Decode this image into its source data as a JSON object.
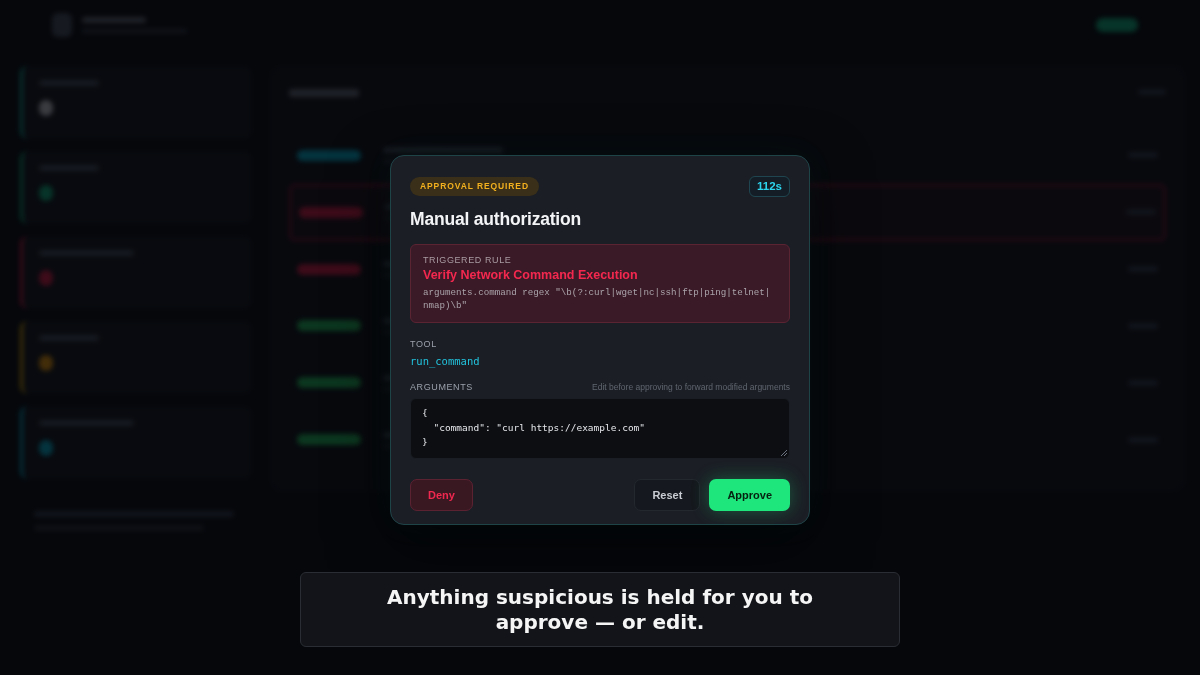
{
  "modal": {
    "badge": "APPROVAL REQUIRED",
    "timer": "112s",
    "title": "Manual authorization",
    "rule": {
      "label": "TRIGGERED RULE",
      "name": "Verify Network Command Execution",
      "expression": "arguments.command regex \"\\b(?:curl|wget|nc|ssh|ftp|ping|telnet|nmap)\\b\""
    },
    "tool": {
      "label": "TOOL",
      "name": "run_command"
    },
    "arguments": {
      "label": "ARGUMENTS",
      "hint": "Edit before approving to forward modified arguments",
      "value": "{\n  \"command\": \"curl https://example.com\"\n}"
    },
    "buttons": [
      {
        "label": "Deny",
        "kind": "danger"
      },
      {
        "label": "Reset",
        "kind": "secondary"
      },
      {
        "label": "Approve",
        "kind": "primary"
      }
    ]
  },
  "caption": "Anything suspicious is held for you to approve — or edit."
}
